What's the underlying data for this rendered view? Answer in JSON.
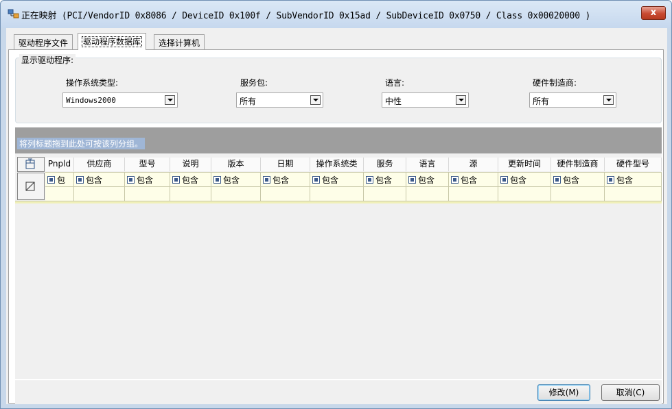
{
  "window": {
    "title": "正在映射 (PCI/VendorID 0x8086 / DeviceID 0x100f / SubVendorID 0x15ad / SubDeviceID 0x0750 / Class 0x00020000 )",
    "close_label": "x"
  },
  "tabs": [
    {
      "label": "驱动程序文件",
      "active": false
    },
    {
      "label": "驱动程序数据库",
      "active": true
    },
    {
      "label": "选择计算机",
      "active": false
    }
  ],
  "filters": {
    "group_title": "显示驱动程序:",
    "os": {
      "label": "操作系统类型:",
      "value": "Windows2000"
    },
    "service_pack": {
      "label": "服务包:",
      "value": "所有"
    },
    "language": {
      "label": "语言:",
      "value": "中性"
    },
    "manufacturer": {
      "label": "硬件制造商:",
      "value": "所有"
    }
  },
  "grid": {
    "group_hint": "将列标题拖到此处可按该列分组。",
    "columns": [
      {
        "label": "Pnpld",
        "filter": "包"
      },
      {
        "label": "供应商",
        "filter": "包含"
      },
      {
        "label": "型号",
        "filter": "包含"
      },
      {
        "label": "说明",
        "filter": "包含"
      },
      {
        "label": "版本",
        "filter": "包含"
      },
      {
        "label": "日期",
        "filter": "包含"
      },
      {
        "label": "操作系统类",
        "filter": "包含"
      },
      {
        "label": "服务",
        "filter": "包含"
      },
      {
        "label": "语言",
        "filter": "包含"
      },
      {
        "label": "源",
        "filter": "包含"
      },
      {
        "label": "更新时间",
        "filter": "包含"
      },
      {
        "label": "硬件制造商",
        "filter": "包含"
      },
      {
        "label": "硬件型号",
        "filter": "包含"
      }
    ]
  },
  "buttons": {
    "modify": "修改(M)",
    "cancel": "取消(C)"
  },
  "colors": {
    "group_bar": "#9e9e9e",
    "filter_row": "#fefee8",
    "titlebar": "#c6d8ee"
  }
}
